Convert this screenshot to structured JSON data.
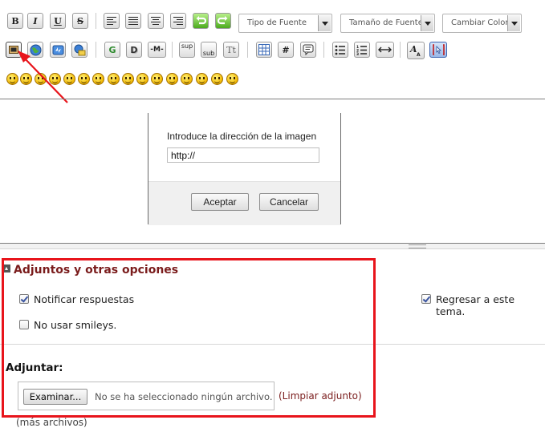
{
  "toolbar": {
    "bold_label": "B",
    "italic_label": "I",
    "underline_label": "U",
    "strike_label": "S",
    "font_family": "Tipo de Fuente",
    "font_size": "Tamaño de Fuente",
    "font_color": "Cambiar Color",
    "g_label": "G",
    "d_label": "D",
    "m_label": "-M-",
    "sup_label": "sup",
    "sub_label": "sub",
    "tt_label": "Tt",
    "hash_label": "#"
  },
  "dialog": {
    "prompt": "Introduce la dirección de la imagen",
    "url_value": "http://",
    "accept_label": "Aceptar",
    "cancel_label": "Cancelar"
  },
  "options": {
    "title": "Adjuntos y otras opciones",
    "notify_label": "Notificar respuestas",
    "return_label": "Regresar a este tema.",
    "no_smileys_label": "No usar smileys."
  },
  "attach": {
    "heading": "Adjuntar:",
    "browse_label": "Examinar...",
    "no_file_label": "No se ha seleccionado ningún archivo.",
    "clear_label": "(Limpiar adjunto)",
    "more_files_label": "(más archivos)"
  },
  "colors": {
    "highlight": "#e8141b",
    "title": "#7a1c1c",
    "link": "#7a1c1c"
  }
}
